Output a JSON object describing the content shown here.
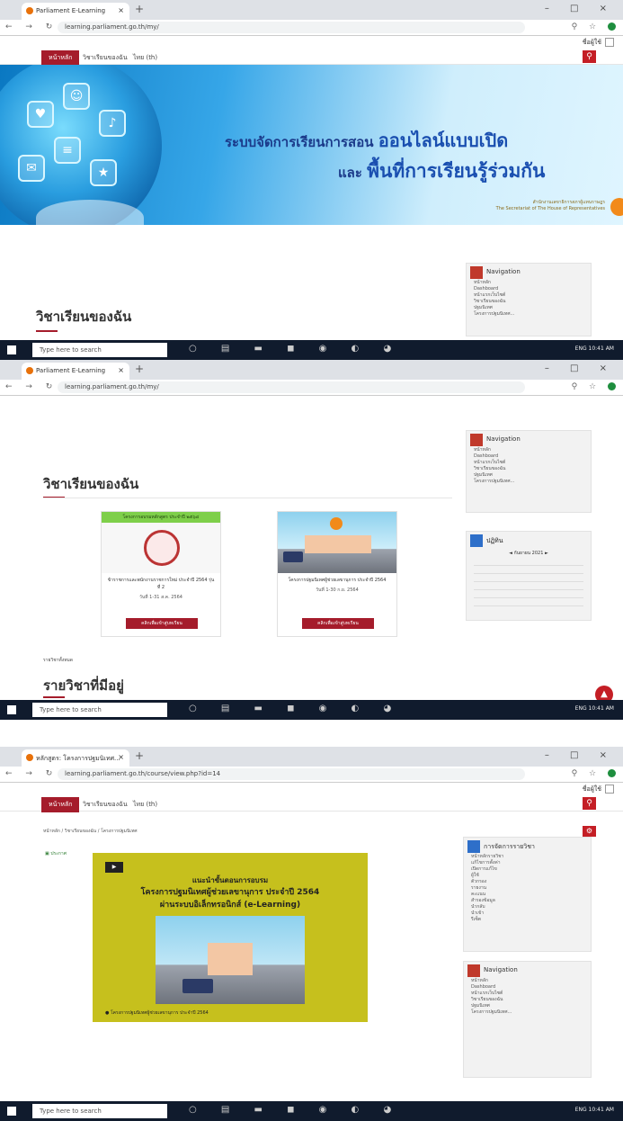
{
  "browser1": {
    "tab_title": "Parliament E-Learning",
    "url": "learning.parliament.go.th/my/"
  },
  "browser2": {
    "tab_title": "Parliament E-Learning",
    "url": "learning.parliament.go.th/my/"
  },
  "browser3": {
    "tab_title": "หลักสูตร: โครงการปฐมนิเทศ...",
    "url": "learning.parliament.go.th/course/view.php?id=14"
  },
  "user": {
    "name": "ชื่อผู้ใช้"
  },
  "menu": {
    "home": "หน้าหลัก",
    "my_courses": "วิชาเรียนของฉัน",
    "thai": "ไทย (th)"
  },
  "banner": {
    "line1_prefix": "ระบบจัดการเรียนการสอน",
    "line1_big": "ออนไลน์แบบเปิด",
    "line2_prefix": "และ",
    "line2_big": "พื้นที่การเรียนรู้ร่วมกัน",
    "org1": "สำนักงานเลขาธิการสภาผู้แทนราษฎร",
    "org2": "The Secretariat of The House of Representatives"
  },
  "section": {
    "my_courses": "วิชาเรียนของฉัน",
    "available": "รายวิชาที่มีอยู่",
    "more": "รายวิชาทั้งหมด"
  },
  "nav_block": {
    "title": "Navigation",
    "items": [
      "หน้าหลัก",
      "Dashboard",
      "หน้าแรกเว็บไซต์",
      "วิชาเรียนของฉัน",
      "ปฐมนิเทศ",
      "โครงการปฐมนิเทศ..."
    ]
  },
  "calendar": {
    "title": "ปฏิทิน",
    "month": "กันยายน 2021"
  },
  "cards": [
    {
      "banner_text": "โครงการอบรมหลักสูตร ประจำปี ๒๕๖๔",
      "title": "ข้าราชการและพนักงานราชการใหม่ ประจำปี 2564 รุ่นที่ 2",
      "date": "วันที่ 1-31 ส.ค. 2564",
      "btn": "คลิกเพื่อเข้าสู่บทเรียน"
    },
    {
      "banner_text": "",
      "title": "โครงการปฐมนิเทศผู้ช่วยเลขานุการ ประจำปี 2564",
      "date": "วันที่ 1-30 ก.ย. 2564",
      "btn": "คลิกเพื่อเข้าสู่บทเรียน"
    }
  ],
  "course_page": {
    "breadcrumb": "หน้าหลัก / วิชาเรียนของฉัน / โครงการปฐมนิเทศ",
    "announce": "ประกาศ",
    "video_l1": "แนะนำขั้นตอนการอบรม",
    "video_l2": "โครงการปฐมนิเทศผู้ช่วยเลขานุการ ประจำปี 2564",
    "video_l3": "ผ่านระบบอิเล็กทรอนิกส์ (e-Learning)",
    "video_foot": "โครงการปฐมนิเทศผู้ช่วยเลขานุการ ประจำปี 2564",
    "side_title": "การจัดการรายวิชา",
    "side_items": [
      "หน้าหลักรายวิชา",
      "แก้ไขการตั้งค่า",
      "เปิดการแก้ไข",
      "ผู้ใช้",
      "ตัวกรอง",
      "รายงาน",
      "คะแนน",
      "สำรองข้อมูล",
      "นำกลับ",
      "นำเข้า",
      "รีเซ็ต"
    ],
    "nav_title": "Navigation"
  },
  "taskbar": {
    "search": "Type here to search",
    "tray": "ENG 10:41 AM"
  }
}
